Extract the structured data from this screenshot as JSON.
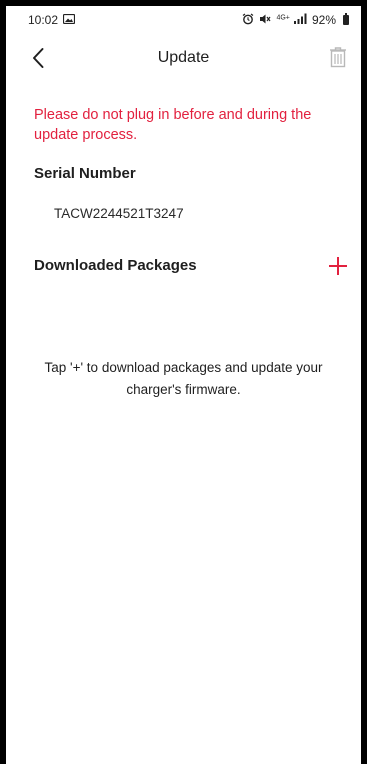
{
  "status_bar": {
    "time": "10:02",
    "network_label": "4G+",
    "battery_percent": "92%"
  },
  "header": {
    "title": "Update",
    "back_icon": "chevron-left-icon",
    "delete_icon": "trash-icon"
  },
  "warning": {
    "text": "Please do not plug in before and during the update process."
  },
  "serial": {
    "label": "Serial Number",
    "value": "TACW2244521T3247"
  },
  "packages": {
    "label": "Downloaded Packages",
    "add_icon": "plus-icon"
  },
  "empty_state": {
    "message": "Tap '+' to download packages and update your charger's firmware."
  },
  "colors": {
    "accent": "#e2213f",
    "text": "#1f1f1f",
    "muted_icon": "#b8b8b8"
  }
}
